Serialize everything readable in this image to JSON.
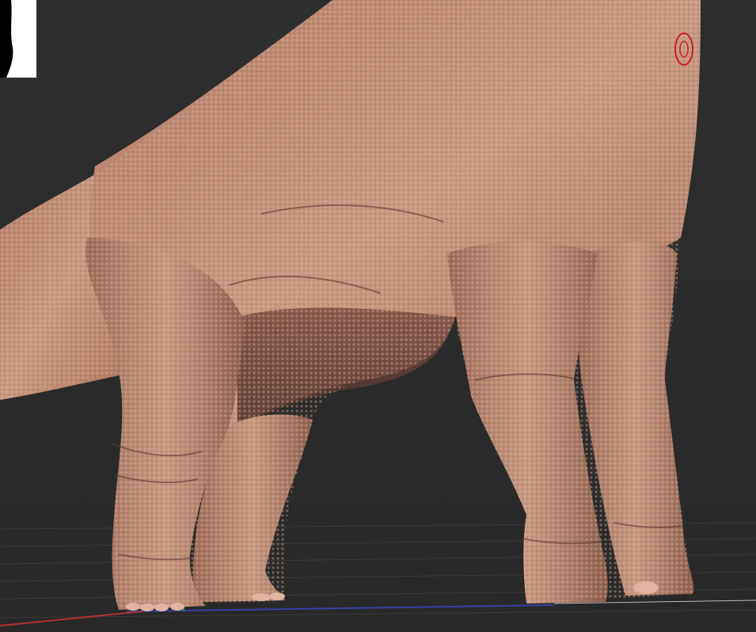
{
  "viewport": {
    "background": "#2b2b2b",
    "grid_color": "#3a3a3a",
    "axis_x_color": "#b03030",
    "axis_y_color": "#2f8f2f",
    "axis_z_color": "#3540a0"
  },
  "model": {
    "skin_light": "#c99a82",
    "skin_mid": "#a8735e",
    "skin_dark": "#5a3a33"
  },
  "navigation_thumbnail": {
    "background": "#ffffff",
    "silhouette": "#000000"
  },
  "brush_cursor": {
    "color": "#c81e1e"
  }
}
